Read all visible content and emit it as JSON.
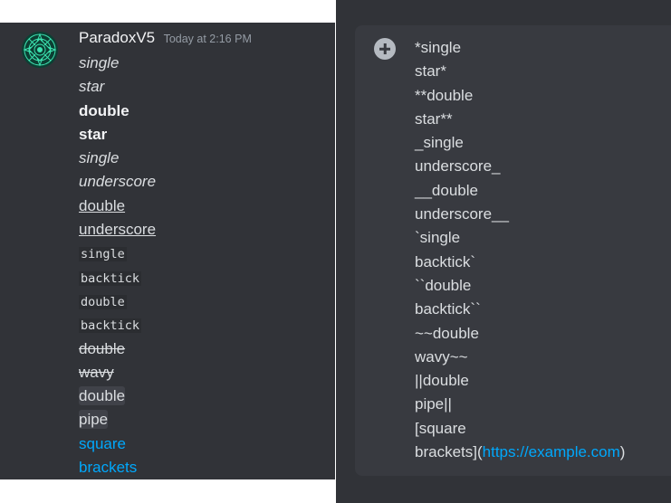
{
  "message": {
    "username": "ParadoxV5",
    "timestamp": "Today at 2:16 PM",
    "avatar_icon": "geometric-mandala-icon",
    "lines": {
      "l1": "single",
      "l2": "star",
      "l3": "double",
      "l4": "star",
      "l5": "single",
      "l6": "underscore",
      "l7": "double",
      "l8": "underscore",
      "l9": "single",
      "l10": "backtick",
      "l11": "double",
      "l12": "backtick",
      "l13": "double",
      "l14": "wavy",
      "l15": "double",
      "l16": "pipe",
      "l17": "square",
      "l18": "brackets"
    }
  },
  "composer": {
    "add_icon": "plus-circle-icon",
    "raw": {
      "r1": "*single",
      "r2": "star*",
      "r3": "**double",
      "r4": "star**",
      "r5": "_single",
      "r6": "underscore_",
      "r7": "__double",
      "r8": "underscore__",
      "r9": "`single",
      "r10": "backtick`",
      "r11": "``double",
      "r12": "backtick``",
      "r13": "~~double",
      "r14": "wavy~~",
      "r15": "||double",
      "r16": "pipe||",
      "r17": "[square",
      "r18_prefix": "brackets](",
      "r18_link": "https://example.com",
      "r18_suffix": ")"
    }
  },
  "colors": {
    "background": "#313338",
    "composer": "#383a40",
    "text": "#dbdee1",
    "link": "#00a8fc",
    "muted": "#949ba4"
  }
}
